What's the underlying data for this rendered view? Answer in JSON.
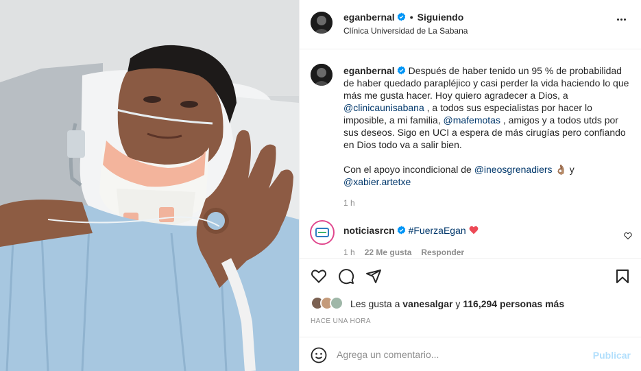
{
  "header": {
    "username": "eganbernal",
    "separator": "•",
    "follow_status": "Siguiendo",
    "location": "Clínica Universidad de La Sabana"
  },
  "caption": {
    "username": "eganbernal",
    "text_1": "Después de haber tenido un 95 % de probabilidad de haber quedado parapléjico y casi perder la vida haciendo lo que más me gusta hacer. Hoy quiero agradecer a Dios, a ",
    "mention_1": "@clinicaunisabana",
    "text_2": " , a todos sus especialistas por hacer lo imposible, a mi familia, ",
    "mention_2": "@mafemotas",
    "text_3": " , amigos y a todos utds por sus deseos. Sigo en UCI a espera de más cirugías pero confiando en Dios todo va a salir bien.",
    "text_4": "Con el apoyo incondicional de ",
    "mention_3": "@ineosgrenadiers",
    "emoji_1": "👌🏽",
    "text_5": " y ",
    "mention_4": "@xabier.artetxe",
    "time": "1 h"
  },
  "comment": {
    "username": "noticiasrcn",
    "hashtag": "#FuerzaEgan",
    "time": "1 h",
    "likes": "22 Me gusta",
    "reply": "Responder"
  },
  "likes_bar": {
    "prefix": "Les gusta a",
    "user": "vanesalgar",
    "connector": "y",
    "count": "116,294 personas más"
  },
  "timestamp": "HACE UNA HORA",
  "add_comment": {
    "placeholder": "Agrega un comentario...",
    "post_label": "Publicar"
  },
  "icons": {
    "verified": "verified-badge-icon",
    "more": "more-options-icon",
    "like": "heart-icon",
    "comment": "comment-icon",
    "share": "share-icon",
    "save": "bookmark-icon",
    "emoji": "emoji-icon"
  },
  "colors": {
    "verified_blue": "#0095f6",
    "link": "#00376b",
    "muted": "#8e8e8e",
    "heart_red": "#ed4956",
    "post_disabled": "#b2dffc"
  }
}
